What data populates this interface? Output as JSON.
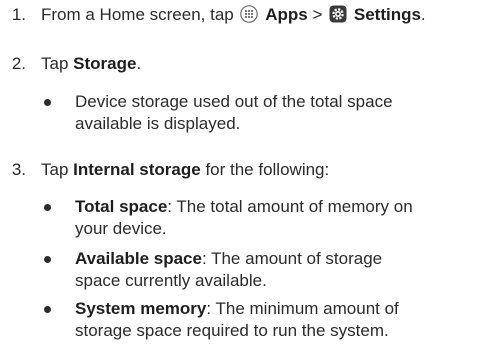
{
  "steps": [
    {
      "number": "1.",
      "prefix": "From a Home screen, tap",
      "apps_label": "Apps",
      "separator": ">",
      "settings_label": "Settings",
      "suffix": "."
    },
    {
      "number": "2.",
      "prefix": "Tap",
      "bold": "Storage",
      "suffix": ".",
      "bullets": [
        {
          "line1": "Device storage used out of the total space",
          "line2": "available is displayed."
        }
      ]
    },
    {
      "number": "3.",
      "prefix": "Tap",
      "bold": "Internal storage",
      "suffix": "for the following:",
      "bullets": [
        {
          "term": "Total space",
          "line1": ": The total amount of memory on",
          "line2": "your device."
        },
        {
          "term": "Available space",
          "line1": ": The amount of storage",
          "line2": "space currently available."
        },
        {
          "term": "System memory",
          "line1": ": The minimum amount of",
          "line2": "storage space required to run the system."
        }
      ]
    }
  ],
  "icons": {
    "apps": "apps-grid-icon",
    "settings": "settings-gear-icon"
  }
}
